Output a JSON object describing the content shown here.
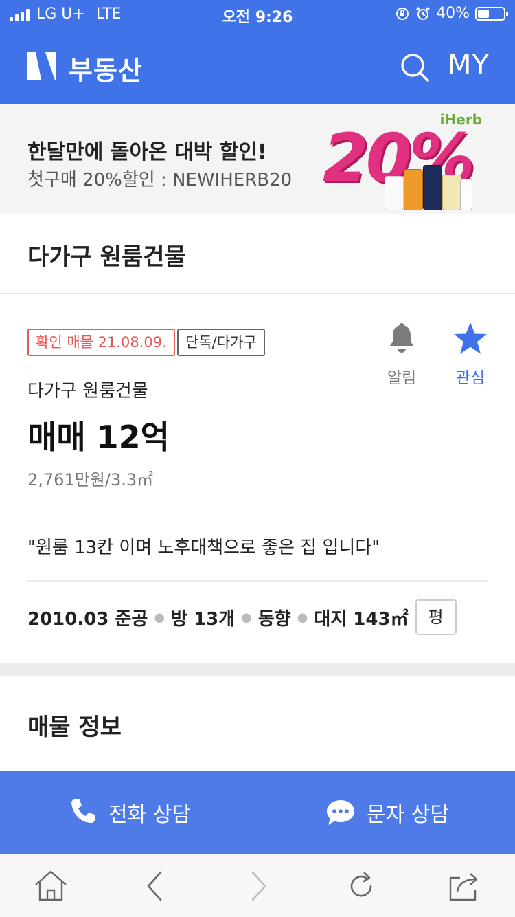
{
  "status_bar": {
    "carrier": "LG U+",
    "network": "LTE",
    "time": "오전 9:26",
    "battery": "40%",
    "battery_level": 0.4
  },
  "header": {
    "logo": "N",
    "title": "부동산",
    "my_label": "MY",
    "bg_color": "#4173e8"
  },
  "ad": {
    "headline": "한달만에 돌아온 대박 할인!",
    "subline": "첫구매 20%할인 : NEWIHERB20",
    "brand": "iHerb",
    "discount": "20%"
  },
  "section_title": "다가구 원룸건물",
  "listing": {
    "tag_verified": "확인 매물 21.08.09.",
    "tag_category": "단독/다가구",
    "alarm_label": "알림",
    "favorite_label": "관심",
    "type": "다가구 원룸건물",
    "price": "매매 12억",
    "unit_price": "2,761만원/3.3㎡",
    "description": "\"원룸 13칸 이며 노후대책으로 좋은 집 입니다\"",
    "specs": {
      "built": "2010.03 준공",
      "rooms": "방 13개",
      "direction": "동향",
      "land": "대지 143㎡",
      "unit_toggle": "평"
    }
  },
  "info_section_title": "매물 정보",
  "action_bar": {
    "call_label": "전화 상담",
    "message_label": "문자 상담"
  },
  "browser_toolbar": {
    "icons": [
      "home-icon",
      "back-icon",
      "forward-icon",
      "refresh-icon",
      "share-icon"
    ]
  }
}
